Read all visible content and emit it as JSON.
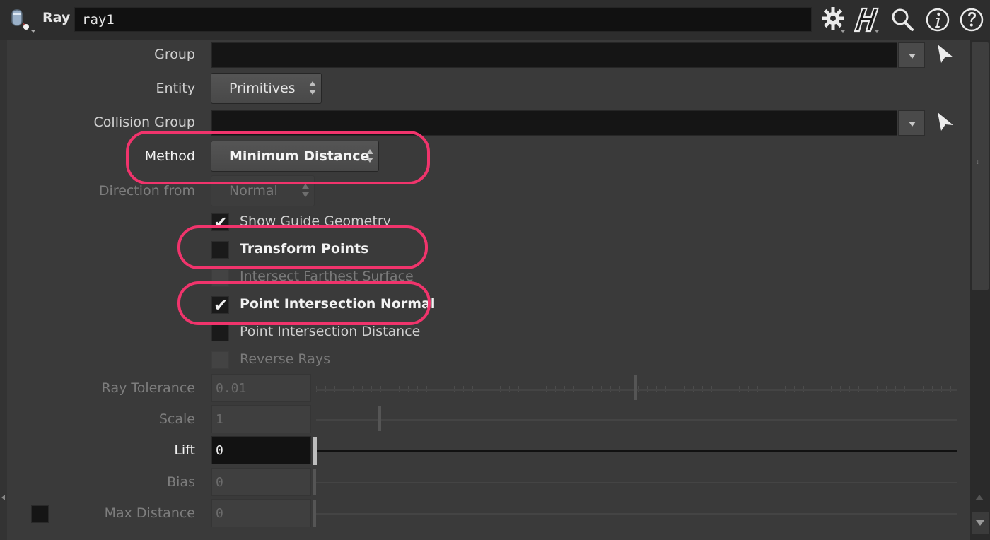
{
  "header": {
    "node_type": "Ray",
    "node_name": "ray1",
    "icons": [
      "ray-node-icon",
      "gear-icon",
      "houdini-h-icon",
      "search-icon",
      "info-icon",
      "help-icon"
    ]
  },
  "params": {
    "group": {
      "label": "Group",
      "value": ""
    },
    "entity": {
      "label": "Entity",
      "value": "Primitives"
    },
    "collision_group": {
      "label": "Collision Group",
      "value": ""
    },
    "method": {
      "label": "Method",
      "value": "Minimum Distance"
    },
    "direction_from": {
      "label": "Direction from",
      "value": "Normal"
    },
    "show_guide": {
      "label": "Show Guide Geometry",
      "checked": true
    },
    "transform_points": {
      "label": "Transform Points",
      "checked": false
    },
    "intersect_farthest": {
      "label": "Intersect Farthest Surface",
      "checked": false
    },
    "point_intersection_normal": {
      "label": "Point Intersection Normal",
      "checked": true
    },
    "point_intersection_distance": {
      "label": "Point Intersection Distance",
      "checked": false
    },
    "reverse_rays": {
      "label": "Reverse Rays",
      "checked": false
    },
    "ray_tolerance": {
      "label": "Ray Tolerance",
      "value": "0.01"
    },
    "scale": {
      "label": "Scale",
      "value": "1"
    },
    "lift": {
      "label": "Lift",
      "value": "0"
    },
    "bias": {
      "label": "Bias",
      "value": "0"
    },
    "max_distance": {
      "label": "Max Distance",
      "value": "0"
    }
  },
  "colors": {
    "annotation": "#f0346c",
    "background": "#3a3a3a",
    "field": "#151515"
  }
}
